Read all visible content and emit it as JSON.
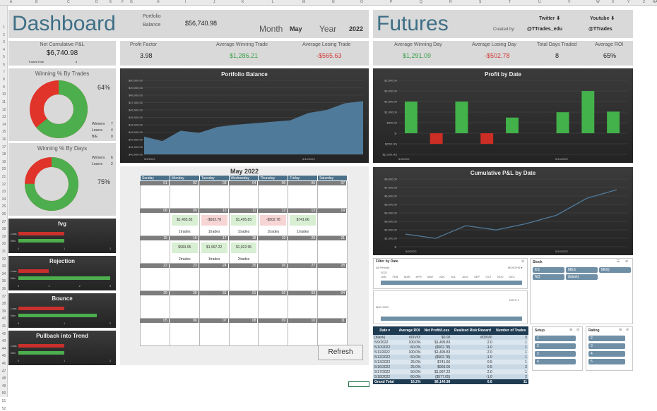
{
  "sheet": {
    "cols": [
      "A",
      "B",
      "C",
      "D",
      "E",
      "F",
      "G",
      "H",
      "I",
      "J",
      "K",
      "L",
      "M",
      "N",
      "O",
      "P",
      "Q",
      "R",
      "S",
      "T",
      "U",
      "V",
      "W",
      "X",
      "Y",
      "Z",
      "AA"
    ],
    "rows": [
      "1",
      "2",
      "3",
      "4",
      "5",
      "6",
      "7",
      "8",
      "9",
      "10",
      "11",
      "12",
      "13",
      "14",
      "15",
      "16",
      "17",
      "18",
      "19",
      "20",
      "21",
      "22",
      "23",
      "24",
      "25",
      "26",
      "27",
      "28",
      "29",
      "30",
      "31",
      "32",
      "33",
      "34",
      "35",
      "36",
      "37",
      "38",
      "39",
      "40",
      "41",
      "42",
      "43",
      "44",
      "45",
      "46",
      "47",
      "48",
      "49",
      "50",
      "51",
      "52"
    ]
  },
  "header": {
    "title": "Dashboard",
    "portfolio_label_1": "Portfolio",
    "portfolio_label_2": "Balance",
    "portfolio_value": "$56,740.98",
    "month_label": "Month",
    "month_value": "May",
    "year_label": "Year",
    "year_value": "2022",
    "futures_title": "Futures",
    "created_by": "Created by:",
    "twitter_label": "Twitter ⬇",
    "twitter_handle": "@TTrades_edu",
    "youtube_label": "Youtube ⬇",
    "youtube_handle": "@TTrades"
  },
  "kpis": {
    "net_pl_label": "Net Cumulative P&L",
    "net_pl_value": "$6,740.98",
    "trades_total_label": "Trades/Total",
    "trades_total_value": "8",
    "profit_factor_label": "Profit Factor",
    "profit_factor_value": "3.98",
    "avg_win_trade_label": "Average Winning Trade",
    "avg_win_trade_value": "$1,286.21",
    "avg_lose_trade_label": "Average Losing Trade",
    "avg_lose_trade_value": "-$565.63",
    "avg_win_day_label": "Average Winning Day",
    "avg_win_day_value": "$1,291.09",
    "avg_lose_day_label": "Average Losing Day",
    "avg_lose_day_value": "-$502.78",
    "total_days_label": "Total Days Traded",
    "total_days_value": "8",
    "avg_roi_label": "Average ROI",
    "avg_roi_value": "65%"
  },
  "win_trades": {
    "title": "Winning % By Trades",
    "pct": "64%",
    "winners_label": "Winners",
    "winners": "7",
    "losers_label": "Losers",
    "losers": "4",
    "be_label": "B/E",
    "be": "0",
    "win_fraction": 0.64,
    "colors": {
      "win": "#4cae4c",
      "loss": "#e0342a"
    }
  },
  "win_days": {
    "title": "Winning % By Days",
    "pct": "75%",
    "winners_label": "Winners",
    "winners": "6",
    "losers_label": "Losers",
    "losers": "2",
    "win_fraction": 0.75
  },
  "setups": [
    {
      "title": "fvg",
      "loss_label": "Loss",
      "win_label": "Win",
      "loss": 1,
      "win": 1,
      "ticks": [
        "0",
        "1",
        "2"
      ],
      "max": 2
    },
    {
      "title": "Rejection",
      "loss_label": "Loss",
      "win_label": "Win",
      "loss": 1,
      "win": 3,
      "ticks": [
        "0",
        "1",
        "2",
        "3"
      ],
      "max": 3
    },
    {
      "title": "Bounce",
      "loss_label": "Loss",
      "win_label": "Win",
      "loss": 1,
      "win": 1.7,
      "ticks": [
        "0",
        "1",
        "2"
      ],
      "max": 2
    },
    {
      "title": "Pullback into Trend",
      "loss_label": "Loss",
      "win_label": "Win",
      "loss": 1,
      "win": 1,
      "ticks": [
        "0",
        "1",
        "2"
      ],
      "max": 2
    }
  ],
  "chart_data": [
    {
      "type": "area",
      "title": "Portfolio Balance",
      "x_labels": [
        "5/9/2022",
        "5/14/2022"
      ],
      "y_ticks": [
        "$50,000.00",
        "$49,000.00",
        "$48,000.00",
        "$47,000.00",
        "$46,000.00",
        "$45,000.00",
        "$44,000.00",
        "$43,000.00",
        "$42,000.00",
        "$41,000.00",
        "$40,000.00"
      ],
      "values": [
        42400,
        41800,
        43200,
        42900,
        43700,
        44000,
        44200,
        44400,
        44600,
        45600,
        46000,
        46900,
        47200
      ],
      "ylim": [
        40000,
        50000
      ]
    },
    {
      "type": "bar",
      "title": "Profit by Date",
      "x_labels": [
        "5/9/2022",
        "5/14/2022"
      ],
      "y_ticks": [
        "$2,500.00",
        "$2,000.00",
        "$1,500.00",
        "$1,000.00",
        "$500.00",
        "$-",
        "$(500.00)",
        "$(1,000.00)"
      ],
      "values": [
        1495.83,
        -502.78,
        1495.83,
        -502.78,
        741.66,
        0,
        993.05,
        1997.22,
        1022.95
      ],
      "ylim": [
        -1000,
        2500
      ]
    },
    {
      "type": "line",
      "title": "Cumulative P&L by Date",
      "x_labels": [
        "5/9/2022",
        "5/14/2022"
      ],
      "y_ticks": [
        "$8,000.00",
        "$7,000.00",
        "$6,000.00",
        "$5,000.00",
        "$4,000.00",
        "$3,000.00",
        "$2,000.00",
        "$1,000.00",
        "$-"
      ],
      "values": [
        1495.83,
        993.05,
        2488.88,
        1986.1,
        2727.76,
        3720.81,
        5718.03,
        6740.98
      ],
      "ylim": [
        0,
        8000
      ]
    }
  ],
  "calendar": {
    "title": "May 2022",
    "days": [
      "Sunday",
      "Monday",
      "Tuesday",
      "Wednesday",
      "Thursday",
      "Friday",
      "Saturday"
    ],
    "weeks": [
      [
        {
          "d": "01"
        },
        {
          "d": "02"
        },
        {
          "d": "03"
        },
        {
          "d": "04"
        },
        {
          "d": "05"
        },
        {
          "d": "06"
        },
        {
          "d": "07"
        }
      ],
      [
        {
          "d": "08"
        },
        {
          "d": "09",
          "pl": "$1,495.83",
          "t": "1trades",
          "s": "pos"
        },
        {
          "d": "10",
          "pl": "-$502.78",
          "t": "1trades",
          "s": "neg"
        },
        {
          "d": "11",
          "pl": "$1,495.83",
          "t": "1trades",
          "s": "pos"
        },
        {
          "d": "12",
          "pl": "-$502.78",
          "t": "1trades",
          "s": "neg"
        },
        {
          "d": "13",
          "pl": "$741.66",
          "t": "1trades",
          "s": "pos"
        },
        {
          "d": "14"
        }
      ],
      [
        {
          "d": "15"
        },
        {
          "d": "16",
          "pl": "$993.05",
          "t": "2trades",
          "s": "pos"
        },
        {
          "d": "17",
          "pl": "$1,997.22",
          "t": "1trades",
          "s": "pos"
        },
        {
          "d": "18",
          "pl": "$1,022.95",
          "t": "2trades",
          "s": "pos"
        },
        {
          "d": "19"
        },
        {
          "d": "20"
        },
        {
          "d": "21"
        }
      ],
      [
        {
          "d": "22"
        },
        {
          "d": "23"
        },
        {
          "d": "24"
        },
        {
          "d": "25"
        },
        {
          "d": "26"
        },
        {
          "d": "27"
        },
        {
          "d": "28"
        }
      ],
      [
        {
          "d": "29"
        },
        {
          "d": "30"
        },
        {
          "d": "31"
        },
        {
          "d": "01"
        },
        {
          "d": "02"
        },
        {
          "d": "03"
        },
        {
          "d": "04"
        }
      ],
      [
        {
          "d": "05"
        },
        {
          "d": "06"
        },
        {
          "d": "07"
        },
        {
          "d": "08"
        },
        {
          "d": "09"
        },
        {
          "d": "10"
        },
        {
          "d": "11"
        }
      ]
    ]
  },
  "refresh_label": "Refresh",
  "filters": {
    "date_title": "Filter by Date",
    "all_periods": "All Periods",
    "months_label": "MONTHS ▾",
    "year_2022": "2022",
    "months": [
      "JAN",
      "FEB",
      "MAR",
      "APR",
      "MAY",
      "JUN",
      "JUL",
      "AUG",
      "SEP",
      "OCT",
      "NOV",
      "DEC"
    ],
    "day_range": "MAY 2022",
    "days_label": "DAYS ▾",
    "stock_title": "Stock",
    "stock_items": [
      "ES",
      "MES",
      "MNQ",
      "NQ",
      "(blank)"
    ],
    "setup_title": "Setup",
    "setup_items": [
      "1",
      "2",
      "3",
      "4"
    ],
    "rating_title": "Rating",
    "rating_items": [
      "2",
      "3",
      "4",
      "5"
    ]
  },
  "pivot": {
    "headers": [
      "Date ▾",
      "Average ROI",
      "Net Profit/Loss",
      "Realized Risk:Reward",
      "Number of Trades"
    ],
    "rows": [
      [
        "(blank)",
        "#DIV/0!",
        "$0.00",
        "#DIV/0!",
        "0"
      ],
      [
        "5/9/2022",
        "100.0%",
        "$1,495.83",
        "2.0",
        "1"
      ],
      [
        "5/10/2022",
        "-50.0%",
        "($502.78)",
        "-1.0",
        "1"
      ],
      [
        "5/11/2022",
        "100.0%",
        "$1,495.83",
        "2.0",
        "1"
      ],
      [
        "5/12/2022",
        "-50.0%",
        "($502.78)",
        "-1.0",
        "1"
      ],
      [
        "5/13/2022",
        "25.0%",
        "$741.66",
        "0.5",
        "1"
      ],
      [
        "5/16/2022",
        "25.0%",
        "$993.05",
        "0.5",
        "2"
      ],
      [
        "5/17/2022",
        "50.0%",
        "$1,997.22",
        "2.0",
        "1"
      ],
      [
        "5/18/2022",
        "-50.0%",
        "($577.05)",
        "-1.0",
        "2"
      ]
    ],
    "total": [
      "Grand Total",
      "16.2%",
      "$6,140.98",
      "0.6",
      "11"
    ]
  }
}
